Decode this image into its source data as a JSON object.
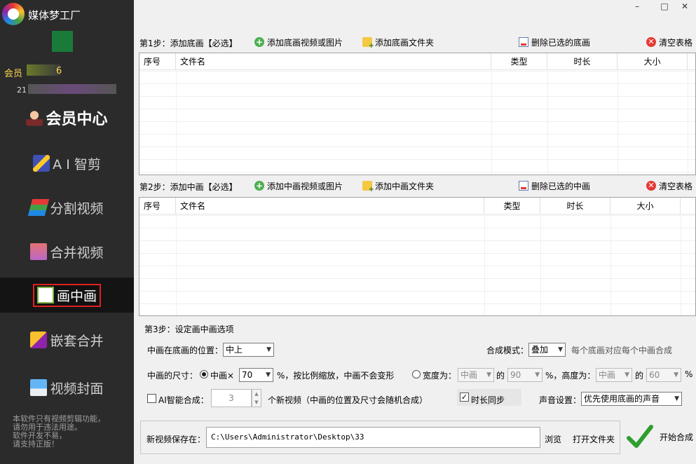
{
  "app": {
    "title": "媒体梦工厂",
    "member_label": "会员",
    "member_num": "6",
    "id_prefix": "21",
    "disclaimer": [
      "本软件只有视频剪辑功能，",
      "请勿用于违法用途。",
      "软件开发不易，",
      "请支持正版！"
    ]
  },
  "window": {
    "minimize": "–",
    "maximize": "□",
    "close": "✕"
  },
  "sidebar": {
    "items": [
      {
        "label": "会员中心",
        "icon": "vip-icon"
      },
      {
        "label": "A I 智剪",
        "icon": "ai-icon"
      },
      {
        "label": "分割视频",
        "icon": "split-icon"
      },
      {
        "label": "合并视频",
        "icon": "merge-icon"
      },
      {
        "label": "画中画",
        "icon": "pip-icon",
        "active": true
      },
      {
        "label": "嵌套合并",
        "icon": "nest-icon"
      },
      {
        "label": "视频封面",
        "icon": "cover-icon"
      }
    ]
  },
  "step1": {
    "label": "第1步：添加底画【必选】",
    "add_media": "添加底画视频或图片",
    "add_folder": "添加底画文件夹",
    "delete_selected": "删除已选的底画",
    "clear": "清空表格",
    "columns": [
      "序号",
      "文件名",
      "类型",
      "时长",
      "大小"
    ]
  },
  "step2": {
    "label": "第2步：添加中画【必选】",
    "add_media": "添加中画视频或图片",
    "add_folder": "添加中画文件夹",
    "delete_selected": "删除已选的中画",
    "clear": "清空表格",
    "columns": [
      "序号",
      "文件名",
      "类型",
      "时长",
      "大小"
    ]
  },
  "step3": {
    "label": "第3步：设定画中画选项",
    "position_label": "中画在底画的位置：",
    "position_value": "中上",
    "blend_label": "合成模式：",
    "blend_value": "叠加",
    "blend_hint": "每个底画对应每个中画合成",
    "size_label": "中画的尺寸：",
    "size_radio_label": "中画×",
    "size_value": "70",
    "size_hint": "%，按比例缩放，中画不会变形",
    "width_radio_label": "宽度为：",
    "width_ref": "中画",
    "of1": "的",
    "width_value": "90",
    "height_label": "%，高度为：",
    "height_ref": "中画",
    "of2": "的",
    "height_value": "60",
    "pct": "%",
    "ai_label": "AI智能合成：",
    "ai_count": "3",
    "ai_hint": "个新视频（中画的位置及尺寸会随机合成）",
    "sync_label": "时长同步",
    "sync_checked": "✓",
    "audio_label": "声音设置：",
    "audio_value": "优先使用底画的声音"
  },
  "output": {
    "save_label": "新视频保存在：",
    "path": "C:\\Users\\Administrator\\Desktop\\33",
    "browse": "浏览",
    "open_folder": "打开文件夹",
    "start": "开始合成"
  }
}
